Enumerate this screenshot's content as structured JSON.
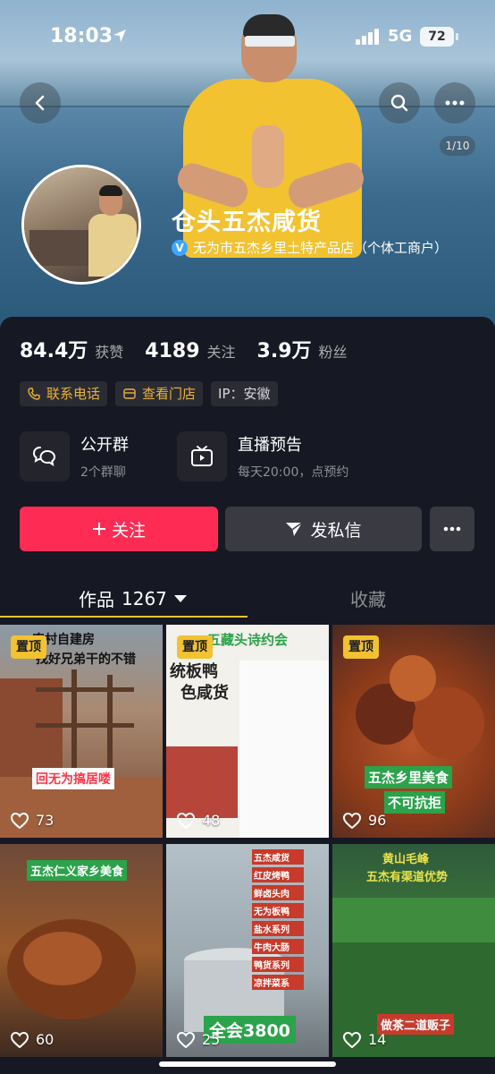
{
  "status_bar": {
    "time": "18:03",
    "network": "5G",
    "battery": "72"
  },
  "header": {
    "page_indicator": "1/10"
  },
  "profile": {
    "name": "仓头五杰咸货",
    "verification": "无为市五杰乡里土特产品店（个体工商户）",
    "stats": [
      {
        "value": "84.4万",
        "label": "获赞"
      },
      {
        "value": "4189",
        "label": "关注"
      },
      {
        "value": "3.9万",
        "label": "粉丝"
      }
    ],
    "tags": {
      "phone": "联系电话",
      "store": "查看门店",
      "ip": "IP：安徽"
    },
    "features": {
      "group": {
        "title": "公开群",
        "subtitle": "2个群聊"
      },
      "live": {
        "title": "直播预告",
        "subtitle": "每天20:00，点预约"
      }
    },
    "actions": {
      "follow": "关注",
      "message": "发私信"
    }
  },
  "tabs": {
    "works_label": "作品",
    "works_count": "1267",
    "favorites_label": "收藏"
  },
  "videos": [
    {
      "pinned": "置顶",
      "likes": "73",
      "caption_top": "农村自建房",
      "caption_top2": "找好兄弟干的不错",
      "caption_mid": "回无为搞居喽"
    },
    {
      "pinned": "置顶",
      "likes": "48",
      "caption_top": "五藏头诗约会",
      "sign_left": "统板鸭",
      "sign_left2": "色咸货"
    },
    {
      "pinned": "置顶",
      "likes": "96",
      "caption_mid": "五杰乡里美食",
      "caption_mid2": "不可抗拒"
    },
    {
      "likes": "60",
      "caption_top": "五杰仁义家乡美食"
    },
    {
      "likes": "25",
      "caption_bottom": "全会3800",
      "menu": [
        "五杰咸货",
        "红皮烤鸭",
        "鲜卤头肉",
        "无为板鸭",
        "盐水系列",
        "牛肉大肠",
        "鸭货系列",
        "凉拌菜系"
      ]
    },
    {
      "likes": "14",
      "caption_top": "黄山毛峰",
      "caption_top2": "五杰有渠道优势",
      "caption_bottom": "做茶二道贩子"
    }
  ]
}
